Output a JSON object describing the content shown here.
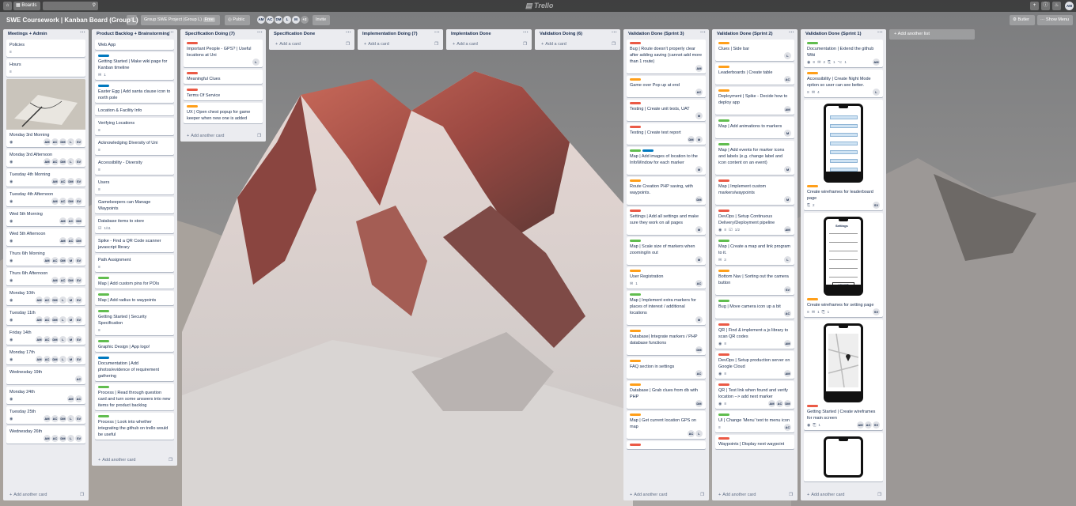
{
  "topbar": {
    "boards_label": "Boards",
    "brand": "Trello",
    "user_initials": "AM"
  },
  "board": {
    "title": "SWE Coursework | Kanban Board (Group L)",
    "team": "Group SWE Project (Group L)",
    "team_badge": "Free",
    "visibility": "Public",
    "members": [
      "AM",
      "AC",
      "DM",
      "L",
      "M"
    ],
    "more_members": "+2",
    "invite": "Invite",
    "butler": "Butler",
    "show_menu": "Show Menu"
  },
  "colors": {
    "green": "#61bd4f",
    "orange": "#ff9f1a",
    "red": "#eb5a46",
    "blue": "#0079bf"
  },
  "add_list": "+ Add another list",
  "lists": [
    {
      "title": "Meetings + Admin",
      "add": "Add another card",
      "cards": [
        {
          "text": "Policies",
          "desc": true
        },
        {
          "text": "Hours",
          "desc": true
        },
        {
          "photo": true,
          "text": "Monday 3rd Morning",
          "watch": true,
          "members": [
            "AM",
            "AC",
            "DM",
            "L",
            "SV"
          ]
        },
        {
          "text": "Monday 3rd Afternoon",
          "watch": true,
          "members": [
            "AM",
            "AC",
            "DM",
            "L",
            "SV"
          ]
        },
        {
          "text": "Tuesday 4th Morning",
          "watch": true,
          "members": [
            "AM",
            "AC",
            "DM",
            "SV"
          ]
        },
        {
          "text": "Tuesday 4th Afternoon",
          "watch": true,
          "members": [
            "AM",
            "AC",
            "DM",
            "SV"
          ]
        },
        {
          "text": "Wed 5th Morning",
          "watch": true,
          "members": [
            "AM",
            "AC",
            "DM"
          ]
        },
        {
          "text": "Wed 5th Afternoon",
          "watch": true,
          "members": [
            "AM",
            "AC",
            "DM"
          ]
        },
        {
          "text": "Thurs 6th Morning",
          "watch": true,
          "members": [
            "AM",
            "AC",
            "DM",
            "M",
            "SV"
          ]
        },
        {
          "text": "Thurs 6th Afternoon",
          "watch": true,
          "members": [
            "AM",
            "AC",
            "DM",
            "SV"
          ]
        },
        {
          "text": "Monday 10th",
          "watch": true,
          "members": [
            "AM",
            "AC",
            "DM",
            "L",
            "M",
            "SV"
          ]
        },
        {
          "text": "Tuesday 11th",
          "watch": true,
          "members": [
            "AM",
            "AC",
            "DM",
            "L",
            "M",
            "SV"
          ]
        },
        {
          "text": "Friday 14th",
          "watch": true,
          "members": [
            "AM",
            "AC",
            "DM",
            "L",
            "M",
            "SV"
          ]
        },
        {
          "text": "Monday 17th",
          "watch": true,
          "members": [
            "AM",
            "AC",
            "DM",
            "L",
            "M",
            "SV"
          ]
        },
        {
          "text": "Wednesday 19th",
          "members": [
            "AC"
          ]
        },
        {
          "text": "Monday 24th",
          "watch": true,
          "members": [
            "AM",
            "AC"
          ]
        },
        {
          "text": "Tuesday 25th",
          "watch": true,
          "members": [
            "AM",
            "AC",
            "DM",
            "L",
            "SV"
          ]
        },
        {
          "text": "Wednesday 26th",
          "members": [
            "AM",
            "AC",
            "DM",
            "L",
            "SV"
          ]
        }
      ]
    },
    {
      "title": "Product Backlog + Brainstorming",
      "add": "Add another card",
      "cards": [
        {
          "text": "Web App"
        },
        {
          "labels": [
            "blue"
          ],
          "text": "Getting Started | Make wiki page for Kanban timeline",
          "comments": "1"
        },
        {
          "labels": [
            "blue"
          ],
          "text": "Easter Egg | Add santa clause icon to north pole"
        },
        {
          "text": "Location & Facility Info"
        },
        {
          "text": "Verifying Locations",
          "desc": true
        },
        {
          "text": "Acknowledging Diversity of Uni",
          "desc": true
        },
        {
          "text": "Accessibility - Diversity",
          "desc": true
        },
        {
          "text": "Users",
          "desc": true
        },
        {
          "text": "Gamekeepers can Manage Waypoints"
        },
        {
          "text": "Database items to store",
          "checklist": "1/11"
        },
        {
          "text": "Spike - Find a QR Code scanner javascript library"
        },
        {
          "text": "Path Assignment",
          "desc": true
        },
        {
          "labels": [
            "green"
          ],
          "text": "Map | Add custom pins for POIs"
        },
        {
          "labels": [
            "green"
          ],
          "text": "Map | Add radius to waypoints"
        },
        {
          "labels": [
            "green"
          ],
          "text": "Getting Started | Security Specification",
          "desc": true
        },
        {
          "labels": [
            "green"
          ],
          "text": "Graphic Design | App logo!"
        },
        {
          "labels": [
            "blue"
          ],
          "text": "Documentation | Add photos/evidence of requirement gathering"
        },
        {
          "labels": [
            "green"
          ],
          "text": "Process | Read through question card and turn some answers into new items for product backlog"
        },
        {
          "labels": [
            "green"
          ],
          "text": "Process | Look into whether integrating the github on trello would be useful"
        }
      ]
    },
    {
      "title": "Specification Doing (7)",
      "add": "Add another card",
      "cards": [
        {
          "labels": [
            "red"
          ],
          "text": "Important People - GPS? | Useful locations at Uni",
          "members": [
            "L"
          ]
        },
        {
          "labels": [
            "red"
          ],
          "text": "Meaningful Clues"
        },
        {
          "labels": [
            "red"
          ],
          "text": "Terms Of Service"
        },
        {
          "labels": [
            "orange"
          ],
          "text": "UX | Open chest popup for game keeper when new one is added"
        }
      ]
    },
    {
      "title": "Specification Done",
      "add": "Add a card",
      "cards": []
    },
    {
      "title": "Implementation Doing (7)",
      "add": "Add a card",
      "cards": []
    },
    {
      "title": "Implentation Done",
      "add": "Add a card",
      "cards": []
    },
    {
      "title": "Validation Doing (6)",
      "add": "Add a card",
      "cards": []
    },
    {
      "title": "Validation Done (Sprint 3)",
      "add": "Add another card",
      "cards": [
        {
          "labels": [
            "red"
          ],
          "text": "Bug | Route doesn't properly clear after adding saving (cannot add more than 1 route)",
          "members": [
            "AM"
          ]
        },
        {
          "labels": [
            "orange"
          ],
          "text": "Game over Pop up at end",
          "members": [
            "AC"
          ]
        },
        {
          "labels": [
            "red"
          ],
          "text": "Testing | Create unit tests, UAT",
          "members": [
            "M"
          ]
        },
        {
          "labels": [
            "red"
          ],
          "text": "Testing | Create test report",
          "members": [
            "DM",
            "M"
          ]
        },
        {
          "labels": [
            "green",
            "blue"
          ],
          "text": "Map | Add images of location to the InfoWindow for each marker",
          "members": [
            "M"
          ]
        },
        {
          "labels": [
            "orange"
          ],
          "text": "Route Creation PHP saving, with waypoints.",
          "members": [
            "DM"
          ]
        },
        {
          "labels": [
            "red"
          ],
          "text": "Settings | Add all settings and make sure they work on all pages",
          "members": [
            "M"
          ]
        },
        {
          "labels": [
            "green"
          ],
          "text": "Map | Scale size of markers when zooming/in out",
          "members": [
            "M"
          ]
        },
        {
          "labels": [
            "orange"
          ],
          "text": "User Registration",
          "comments": "1",
          "members": [
            "AC"
          ]
        },
        {
          "labels": [
            "green"
          ],
          "text": "Map | Implement extra markers for places of interest / additional locations",
          "members": [
            "M"
          ]
        },
        {
          "labels": [
            "orange"
          ],
          "text": "Database| Integrate markers / PHP database functions",
          "members": [
            "DM"
          ]
        },
        {
          "labels": [
            "orange"
          ],
          "text": "FAQ section in settings",
          "members": [
            "AC"
          ]
        },
        {
          "labels": [
            "orange"
          ],
          "text": "Database | Grab clues from db with PHP",
          "members": [
            "DM"
          ]
        },
        {
          "labels": [
            "orange"
          ],
          "text": "Map | Get current location GPS on map",
          "members": [
            "AC",
            "L"
          ]
        },
        {
          "labels": [
            "red"
          ],
          "text": ""
        }
      ]
    },
    {
      "title": "Validation Done (Sprint 2)",
      "add": "Add another card",
      "cards": [
        {
          "labels": [
            "orange"
          ],
          "text": "Clues | Side bar",
          "members": [
            "L"
          ]
        },
        {
          "labels": [
            "orange"
          ],
          "text": "Leaderboards | Create table",
          "members": [
            "AC"
          ]
        },
        {
          "labels": [
            "orange"
          ],
          "text": "Deployment | Spike - Decide how to deploy app",
          "members": [
            "AM"
          ]
        },
        {
          "labels": [
            "green"
          ],
          "text": "Map | Add animations to markers",
          "members": [
            "M"
          ]
        },
        {
          "labels": [
            "green"
          ],
          "text": "Map | Add events for marker icons and labels (e.g. change label and icon content on an event)",
          "members": [
            "M"
          ]
        },
        {
          "labels": [
            "red"
          ],
          "text": "Map | Implement custom markers/waypoints",
          "members": [
            "M"
          ]
        },
        {
          "labels": [
            "red"
          ],
          "text": "DevOps | Setup Continuous Delivery/Deployment pipeline",
          "watch": true,
          "desc": true,
          "checklist": "1/2",
          "members": [
            "AM"
          ]
        },
        {
          "labels": [
            "green"
          ],
          "text": "Map | Create a map and link program to it.",
          "comments": "3",
          "members": [
            "L"
          ]
        },
        {
          "labels": [
            "orange"
          ],
          "text": "Bottom Nav | Sorting out the camera button",
          "members": [
            "SV"
          ]
        },
        {
          "labels": [
            "green"
          ],
          "text": "Bug | Move camera icon up a bit",
          "members": [
            "AC"
          ]
        },
        {
          "labels": [
            "red"
          ],
          "text": "QR | Find & implement a js library to scan QR codes",
          "watch": true,
          "desc": true,
          "members": [
            "AM"
          ]
        },
        {
          "labels": [
            "red"
          ],
          "text": "DevOps | Setup production server on Google Cloud",
          "watch": true,
          "desc": true,
          "members": [
            "AM"
          ]
        },
        {
          "labels": [
            "red"
          ],
          "text": "QR | Test link when found and verify location --> add next marker",
          "watch": true,
          "desc": true,
          "members": [
            "AM",
            "AC",
            "DM"
          ]
        },
        {
          "labels": [
            "green"
          ],
          "text": "UI | Change 'Menu' text to menu icon",
          "desc": true,
          "members": [
            "AC"
          ]
        },
        {
          "labels": [
            "red"
          ],
          "text": "Waypoints | Display next waypoint"
        }
      ]
    },
    {
      "title": "Validation Done (Sprint 1)",
      "add": "Add another card",
      "cards": [
        {
          "labels": [
            "green"
          ],
          "text": "Documentation | Extend the github Wiki",
          "watch": true,
          "desc": true,
          "comments": "2",
          "attachments": "1",
          "commits": "1",
          "members": [
            "AM"
          ]
        },
        {
          "labels": [
            "orange"
          ],
          "text": "Accessibility | Create Night Mode option so user can see better.",
          "desc": true,
          "comments": "4",
          "members": [
            "L"
          ]
        },
        {
          "phone": "leaderboard",
          "labels": [
            "orange"
          ],
          "text": "Create wireframes for leaderboard page",
          "attachments": "2",
          "members": [
            "SV"
          ]
        },
        {
          "phone": "settings",
          "phone_title": "Settings",
          "phone_btn": "LOG OUT",
          "labels": [
            "orange"
          ],
          "text": "Create wireframes for setting page",
          "desc": true,
          "comments": "1",
          "attachments": "1",
          "members": [
            "SV"
          ]
        },
        {
          "phone": "map",
          "labels": [
            "red"
          ],
          "text": "Getting Started | Create wireframes for main screen",
          "watch": true,
          "attachments": "1",
          "members": [
            "AM",
            "AC",
            "SV"
          ]
        },
        {
          "phone": "partial",
          "text": ""
        }
      ]
    }
  ]
}
